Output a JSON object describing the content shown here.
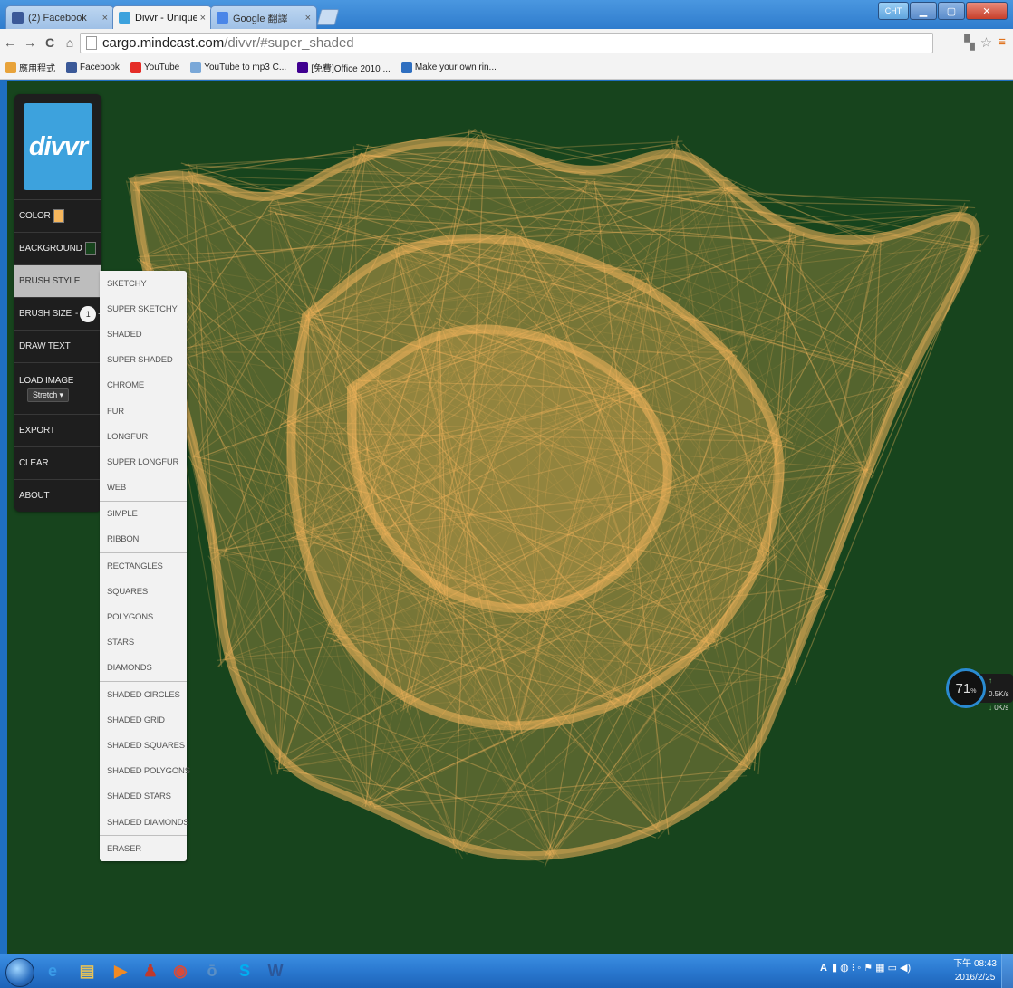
{
  "browser": {
    "tabs": [
      {
        "title": "(2) Facebook",
        "close": "×",
        "active": false,
        "icon": "facebook-icon",
        "color": "#3b5998"
      },
      {
        "title": "Divvr - Unique Drawing /",
        "close": "×",
        "active": true,
        "icon": "divvr-icon",
        "color": "#3da2dd"
      },
      {
        "title": "Google 翻譯",
        "close": "×",
        "active": false,
        "icon": "google-translate-icon",
        "color": "#4a86e8"
      }
    ],
    "url_host": "cargo.mindcast.com",
    "url_path": "/divvr/#super_shaded",
    "nav": {
      "back": "←",
      "forward": "→",
      "reload": "C",
      "home": "⌂"
    },
    "bookmarks": [
      {
        "label": "應用程式",
        "icon": "apps-icon",
        "color": "#e8a33a"
      },
      {
        "label": "Facebook",
        "icon": "facebook-icon",
        "color": "#3b5998"
      },
      {
        "label": "YouTube",
        "icon": "youtube-icon",
        "color": "#e52d27"
      },
      {
        "label": "YouTube to mp3 C...",
        "icon": "converter-icon",
        "color": "#7aa8d8"
      },
      {
        "label": "[免費]Office 2010 ...",
        "icon": "yahoo-icon",
        "color": "#400090"
      },
      {
        "label": "Make your own rin...",
        "icon": "ringtone-icon",
        "color": "#2f6fc0"
      }
    ],
    "window_lang": "CHT"
  },
  "app": {
    "logo": "divvr",
    "menu": {
      "color": "COLOR",
      "background": "BACKGROUND",
      "brush_style": "BRUSH STYLE",
      "brush_size": "BRUSH SIZE",
      "brush_size_value": "1",
      "brush_size_minus": "-",
      "brush_size_plus": "+",
      "draw_text": "DRAW TEXT",
      "load_image": "LOAD IMAGE",
      "load_image_mode": "Stretch",
      "export": "EXPORT",
      "clear": "CLEAR",
      "about": "ABOUT"
    },
    "colors": {
      "brush": "#f6b65c",
      "background": "#17441d"
    },
    "brush_styles": [
      "SKETCHY",
      "SUPER SKETCHY",
      "SHADED",
      "SUPER SHADED",
      "CHROME",
      "FUR",
      "LONGFUR",
      "SUPER LONGFUR",
      "WEB",
      "SIMPLE",
      "RIBBON",
      "RECTANGLES",
      "SQUARES",
      "POLYGONS",
      "STARS",
      "DIAMONDS",
      "SHADED CIRCLES",
      "SHADED GRID",
      "SHADED SQUARES",
      "SHADED POLYGONS",
      "SHADED STARS",
      "SHADED DIAMONDS",
      "ERASER"
    ],
    "brush_style_separators": [
      "SIMPLE",
      "RECTANGLES",
      "SHADED CIRCLES",
      "ERASER"
    ]
  },
  "netmeter": {
    "percent": "71",
    "unit": "%",
    "up": "0.5K/s",
    "down": "0K/s"
  },
  "taskbar": {
    "apps": [
      {
        "name": "ie-icon",
        "glyph": "e",
        "color": "#3a9be8"
      },
      {
        "name": "explorer-icon",
        "glyph": "▤",
        "color": "#e7c257"
      },
      {
        "name": "media-player-icon",
        "glyph": "▶",
        "color": "#f08a24"
      },
      {
        "name": "game-icon",
        "glyph": "♟",
        "color": "#c0392b"
      },
      {
        "name": "chrome-icon",
        "glyph": "◉",
        "color": "#d84b3a"
      },
      {
        "name": "app-icon",
        "glyph": "ō",
        "color": "#5a8fc6"
      },
      {
        "name": "skype-icon",
        "glyph": "S",
        "color": "#00aff0"
      },
      {
        "name": "word-icon",
        "glyph": "W",
        "color": "#2b579a"
      }
    ],
    "tray": "A",
    "time": "下午 08:43",
    "date": "2016/2/25"
  }
}
